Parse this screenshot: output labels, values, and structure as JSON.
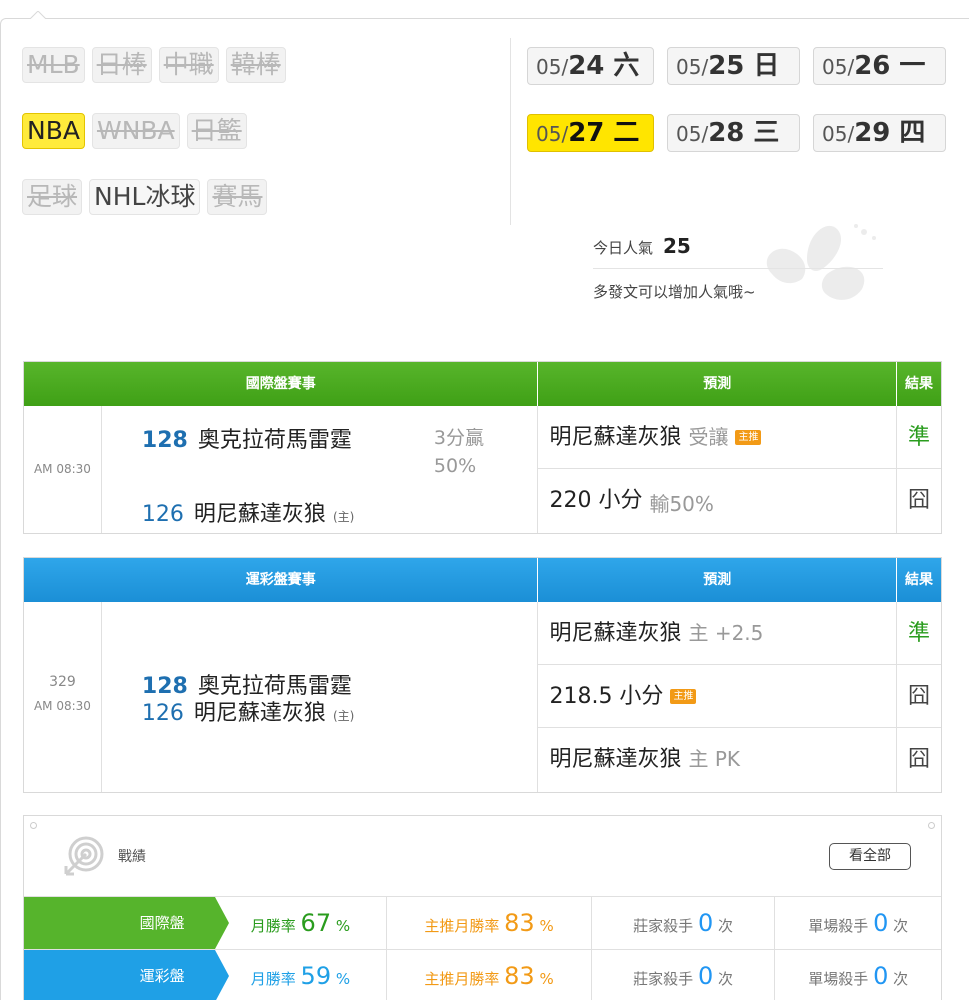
{
  "sports": {
    "row1": [
      "MLB",
      "日棒",
      "中職",
      "韓棒"
    ],
    "row2": [
      "NBA",
      "WNBA",
      "日籃"
    ],
    "row3": [
      "足球",
      "NHL冰球",
      "賽馬"
    ]
  },
  "dates": [
    {
      "md": "05/",
      "day": "24 六"
    },
    {
      "md": "05/",
      "day": "25 日"
    },
    {
      "md": "05/",
      "day": "26 一"
    },
    {
      "md": "05/",
      "day": "27 二"
    },
    {
      "md": "05/",
      "day": "28 三"
    },
    {
      "md": "05/",
      "day": "29 四"
    }
  ],
  "popularity": {
    "label": "今日人氣",
    "value": "25",
    "hint": "多發文可以增加人氣哦~"
  },
  "intl": {
    "header": {
      "game": "國際盤賽事",
      "pred": "預測",
      "result": "結果"
    },
    "time": "AM 08:30",
    "away": {
      "score": "128",
      "name": "奧克拉荷馬雷霆"
    },
    "home": {
      "score": "126",
      "name": "明尼蘇達灰狼",
      "tag": "(主)"
    },
    "spread": {
      "line": "3分贏",
      "pct": "50%"
    },
    "preds": [
      {
        "text": "明尼蘇達灰狼",
        "sub": "受讓",
        "badge": "主推"
      },
      {
        "text": "220 小分",
        "sub": "輸50%"
      }
    ],
    "results": [
      "準",
      "囧"
    ]
  },
  "lottery": {
    "header": {
      "game": "運彩盤賽事",
      "pred": "預測",
      "result": "結果"
    },
    "no": "329",
    "time": "AM 08:30",
    "away": {
      "score": "128",
      "name": "奧克拉荷馬雷霆"
    },
    "home": {
      "score": "126",
      "name": "明尼蘇達灰狼",
      "tag": "(主)"
    },
    "preds": [
      {
        "text": "明尼蘇達灰狼",
        "sub": "主 +2.5"
      },
      {
        "text": "218.5 小分",
        "badge": "主推"
      },
      {
        "text": "明尼蘇達灰狼",
        "sub": "主 PK"
      }
    ],
    "results": [
      "準",
      "囧",
      "囧"
    ]
  },
  "record": {
    "title": "戰績",
    "all_button": "看全部",
    "rows": [
      {
        "label": "國際盤",
        "month_label": "月勝率",
        "month": "67",
        "main_label": "主推月勝率",
        "main": "83",
        "pct": "%",
        "dealer_label": "莊家殺手",
        "dealer": "0",
        "single_label": "單場殺手",
        "single": "0",
        "times": "次"
      },
      {
        "label": "運彩盤",
        "month_label": "月勝率",
        "month": "59",
        "main_label": "主推月勝率",
        "main": "83",
        "pct": "%",
        "dealer_label": "莊家殺手",
        "dealer": "0",
        "single_label": "單場殺手",
        "single": "0",
        "times": "次"
      }
    ]
  },
  "colors": {
    "intl": "#56b42c",
    "lottery": "#1fa0e6",
    "highlight": "#ffe500",
    "win": "#2a9c1e",
    "main_badge": "#f29a16"
  }
}
